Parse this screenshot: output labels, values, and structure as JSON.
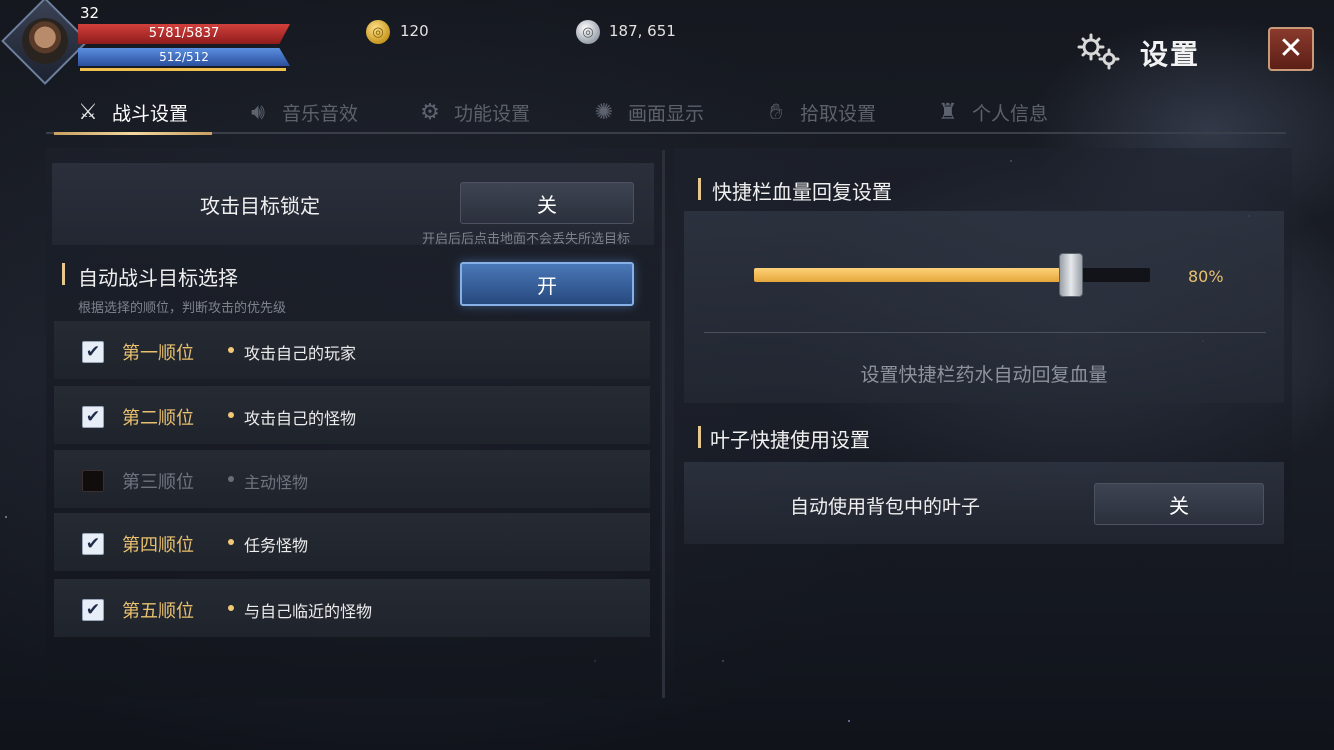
{
  "hud": {
    "level": "32",
    "hp": "5781/5837",
    "mp": "512/512",
    "gold_icon": "gold-coin-icon",
    "gold": "120",
    "silver_icon": "silver-coin-icon",
    "silver": "187, 651"
  },
  "header": {
    "title": "设置",
    "close_icon": "close-icon"
  },
  "tabs": [
    {
      "label": "战斗设置",
      "icon": "crossed-swords-icon",
      "active": true
    },
    {
      "label": "音乐音效",
      "icon": "speaker-icon",
      "active": false
    },
    {
      "label": "功能设置",
      "icon": "gear-icon",
      "active": false
    },
    {
      "label": "画面显示",
      "icon": "display-icon",
      "active": false
    },
    {
      "label": "拾取设置",
      "icon": "hand-icon",
      "active": false
    },
    {
      "label": "个人信息",
      "icon": "helmet-icon",
      "active": false
    }
  ],
  "left": {
    "target_lock": {
      "label": "攻击目标锁定",
      "toggle": "关",
      "hint": "开启后后点击地面不会丢失所选目标"
    },
    "auto_target": {
      "title": "自动战斗目标选择",
      "hint": "根据选择的顺位，判断攻击的优先级",
      "toggle": "开"
    },
    "priorities": [
      {
        "rank": "第一顺位",
        "target": "攻击自己的玩家",
        "checked": true
      },
      {
        "rank": "第二顺位",
        "target": "攻击自己的怪物",
        "checked": true
      },
      {
        "rank": "第三顺位",
        "target": "主动怪物",
        "checked": false
      },
      {
        "rank": "第四顺位",
        "target": "任务怪物",
        "checked": true
      },
      {
        "rank": "第五顺位",
        "target": "与自己临近的怪物",
        "checked": true
      }
    ]
  },
  "right": {
    "hp_recovery": {
      "title": "快捷栏血量回复设置",
      "percent_value": 80,
      "percent_label": "80%",
      "description": "设置快捷栏药水自动回复血量"
    },
    "leaf": {
      "title": "叶子快捷使用设置",
      "label": "自动使用背包中的叶子",
      "toggle": "关"
    }
  },
  "colors": {
    "accent_gold": "#e8c070",
    "toggle_on_blue": "#4a78b8",
    "close_red": "#8a3a2c",
    "slider_fill": "#f2b84e"
  }
}
